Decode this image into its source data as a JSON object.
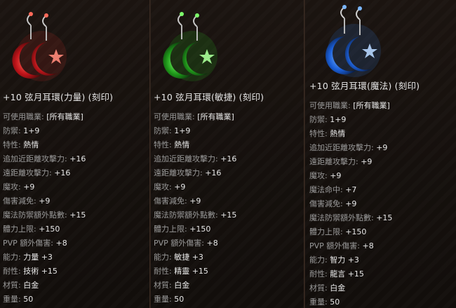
{
  "items": [
    {
      "theme": "red",
      "title": "+10 弦月耳環(力量) (刻印)",
      "stats": [
        {
          "k": "可使用職業:",
          "v": "[所有職業]"
        },
        {
          "k": "防禦:",
          "v": "1+9"
        },
        {
          "k": "特性:",
          "v": "熱情"
        },
        {
          "k": "追加近距離攻擊力:",
          "v": "+16"
        },
        {
          "k": "遠距離攻擊力:",
          "v": "+16"
        },
        {
          "k": "魔攻:",
          "v": "+9"
        },
        {
          "k": "傷害減免:",
          "v": "+9"
        },
        {
          "k": "魔法防禦額外點數:",
          "v": "+15"
        },
        {
          "k": "體力上限:",
          "v": "+150"
        },
        {
          "k": "PVP 額外傷害:",
          "v": "+8"
        },
        {
          "k": "能力:",
          "v": "力量 +3"
        },
        {
          "k": "耐性:",
          "v": "技術 +15"
        },
        {
          "k": "材質:",
          "v": "白金"
        },
        {
          "k": "重量:",
          "v": "50"
        }
      ]
    },
    {
      "theme": "green",
      "title": "+10 弦月耳環(敏捷) (刻印)",
      "stats": [
        {
          "k": "可使用職業:",
          "v": "[所有職業]"
        },
        {
          "k": "防禦:",
          "v": "1+9"
        },
        {
          "k": "特性:",
          "v": "熱情"
        },
        {
          "k": "追加近距離攻擊力:",
          "v": "+16"
        },
        {
          "k": "遠距離攻擊力:",
          "v": "+16"
        },
        {
          "k": "魔攻:",
          "v": "+9"
        },
        {
          "k": "傷害減免:",
          "v": "+9"
        },
        {
          "k": "魔法防禦額外點數:",
          "v": "+15"
        },
        {
          "k": "體力上限:",
          "v": "+150"
        },
        {
          "k": "PVP 額外傷害:",
          "v": "+8"
        },
        {
          "k": "能力:",
          "v": "敏捷 +3"
        },
        {
          "k": "耐性:",
          "v": "精靈 +15"
        },
        {
          "k": "材質:",
          "v": "白金"
        },
        {
          "k": "重量:",
          "v": "50"
        }
      ]
    },
    {
      "theme": "blue",
      "title": "+10 弦月耳環(魔法) (刻印)",
      "stats": [
        {
          "k": "可使用職業:",
          "v": "[所有職業]"
        },
        {
          "k": "防禦:",
          "v": "1+9"
        },
        {
          "k": "特性:",
          "v": "熱情"
        },
        {
          "k": "追加近距離攻擊力:",
          "v": "+9"
        },
        {
          "k": "遠距離攻擊力:",
          "v": "+9"
        },
        {
          "k": "魔攻:",
          "v": "+9"
        },
        {
          "k": "魔法命中:",
          "v": "+7"
        },
        {
          "k": "傷害減免:",
          "v": "+9"
        },
        {
          "k": "魔法防禦額外點數:",
          "v": "+15"
        },
        {
          "k": "體力上限:",
          "v": "+150"
        },
        {
          "k": "PVP 額外傷害:",
          "v": "+8"
        },
        {
          "k": "能力:",
          "v": "智力 +3"
        },
        {
          "k": "耐性:",
          "v": "龍言 +15"
        },
        {
          "k": "材質:",
          "v": "白金"
        },
        {
          "k": "重量:",
          "v": "50"
        }
      ]
    }
  ],
  "colors": {
    "red": {
      "dark": "#5a0a0a",
      "main": "#c0141a",
      "light": "#ff6a5a",
      "glow": "#ff3b2f"
    },
    "green": {
      "dark": "#0b3a0b",
      "main": "#1f9a1a",
      "light": "#7dff6a",
      "glow": "#34ff2a"
    },
    "blue": {
      "dark": "#08245a",
      "main": "#1b5fd8",
      "light": "#7ab6ff",
      "glow": "#3a8bff"
    }
  }
}
